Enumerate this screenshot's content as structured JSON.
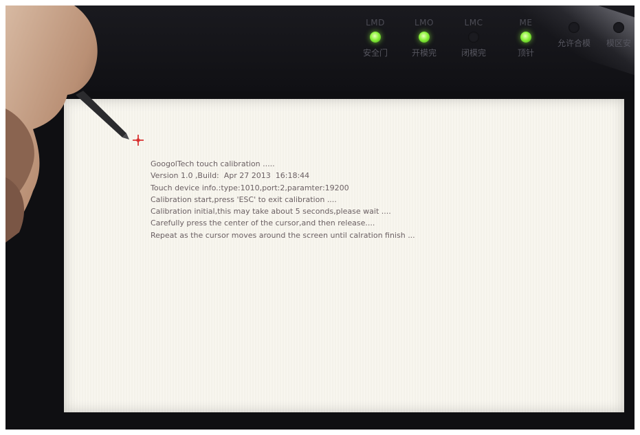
{
  "indicators": [
    {
      "code": "LMD",
      "caption": "安全门",
      "state": "on"
    },
    {
      "code": "LMO",
      "caption": "开模完",
      "state": "on"
    },
    {
      "code": "LMC",
      "caption": "闭模完",
      "state": "off"
    },
    {
      "code": "ME",
      "caption": "顶针",
      "state": "on"
    },
    {
      "code": "",
      "caption": "允许合模",
      "state": "off"
    },
    {
      "code": "",
      "caption": "模区安",
      "state": "off"
    }
  ],
  "calibration": {
    "lines": [
      "GoogolTech touch calibration .....",
      "Version 1.0 ,Build:  Apr 27 2013  16:18:44",
      "Touch device info.:type:1010,port:2,paramter:19200",
      "Calibration start,press 'ESC' to exit calibration ....",
      "Calibration initial,this may take about 5 seconds,please wait ....",
      "Carefully press the center of the cursor,and then release....",
      "Repeat as the cursor moves around the screen until calration finish ..."
    ]
  },
  "colors": {
    "led_on": "#8cf23c",
    "cursor": "#d62020",
    "text": "#6a5f62",
    "screen": "#f8f6ef"
  },
  "icons": {
    "calibration_cursor": "crosshair-cursor-icon"
  }
}
